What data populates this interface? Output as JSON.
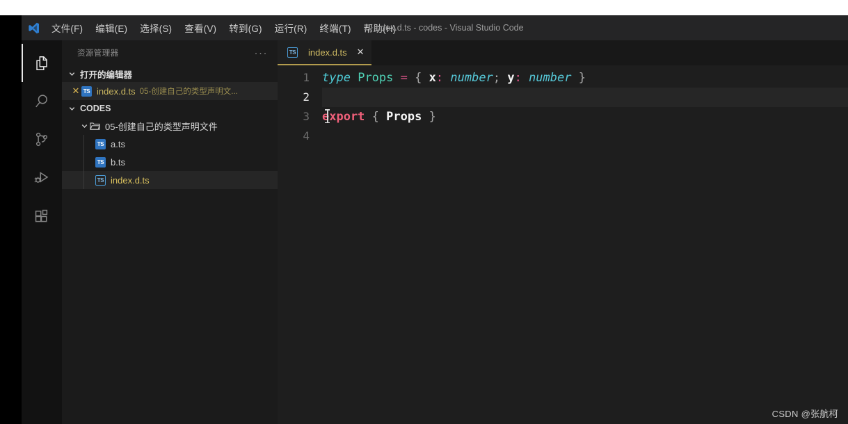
{
  "window": {
    "title": "index.d.ts - codes - Visual Studio Code",
    "logo_icon": "vscode-logo-icon"
  },
  "menubar": {
    "items": [
      {
        "label": "文件(F)",
        "name": "menu-file"
      },
      {
        "label": "编辑(E)",
        "name": "menu-edit"
      },
      {
        "label": "选择(S)",
        "name": "menu-selection"
      },
      {
        "label": "查看(V)",
        "name": "menu-view"
      },
      {
        "label": "转到(G)",
        "name": "menu-goto"
      },
      {
        "label": "运行(R)",
        "name": "menu-run"
      },
      {
        "label": "终端(T)",
        "name": "menu-terminal"
      },
      {
        "label": "帮助(H)",
        "name": "menu-help"
      }
    ]
  },
  "activity_bar": {
    "items": [
      {
        "icon": "files-explorer-icon",
        "active": true
      },
      {
        "icon": "search-icon",
        "active": false
      },
      {
        "icon": "source-control-icon",
        "active": false
      },
      {
        "icon": "run-and-debug-icon",
        "active": false
      },
      {
        "icon": "extensions-icon",
        "active": false
      }
    ]
  },
  "sidebar": {
    "title": "资源管理器",
    "more_actions": "···",
    "open_editors": {
      "label": "打开的编辑器",
      "items": [
        {
          "close": "✕",
          "icon": "typescript-file-icon",
          "name": "index.d.ts",
          "path": "05-创建自己的类型声明文..."
        }
      ]
    },
    "workspace": {
      "label": "CODES",
      "folder": {
        "name": "05-创建自己的类型声明文件",
        "icon": "folder-open-icon",
        "files": [
          {
            "name": "a.ts",
            "icon": "typescript-file-icon",
            "active": false
          },
          {
            "name": "b.ts",
            "icon": "typescript-file-icon",
            "active": false
          },
          {
            "name": "index.d.ts",
            "icon": "typescript-declaration-file-icon",
            "active": true
          }
        ]
      }
    }
  },
  "editor": {
    "tabs": [
      {
        "icon": "typescript-declaration-file-icon",
        "label": "index.d.ts",
        "close": "✕",
        "active": true
      }
    ],
    "lines": [
      {
        "number": "1",
        "active": false
      },
      {
        "number": "2",
        "active": true
      },
      {
        "number": "3",
        "active": false
      },
      {
        "number": "4",
        "active": false
      }
    ],
    "code": {
      "line1": {
        "type_kw": "type",
        "type_name": "Props",
        "equals": "=",
        "brace_open": "{",
        "prop_x": "x",
        "colon1": ":",
        "number1": "number",
        "semicolon": ";",
        "prop_y": "y",
        "colon2": ":",
        "number2": "number",
        "brace_close": "}"
      },
      "line3": {
        "export_kw": "export",
        "brace_open": "{",
        "identifier": "Props",
        "brace_close": "}"
      }
    }
  },
  "watermark": "CSDN @张航柯",
  "colors": {
    "editor_background": "#1e1e1e",
    "sidebar_background": "#1b1b1b",
    "activity_bar_background": "#121212",
    "title_bar_background": "#252526",
    "active_tab_border": "#b39c4d",
    "accent_yellow": "#d0bb63",
    "keyword_pink": "#f0607a",
    "type_cyan": "#4ec9d4"
  }
}
